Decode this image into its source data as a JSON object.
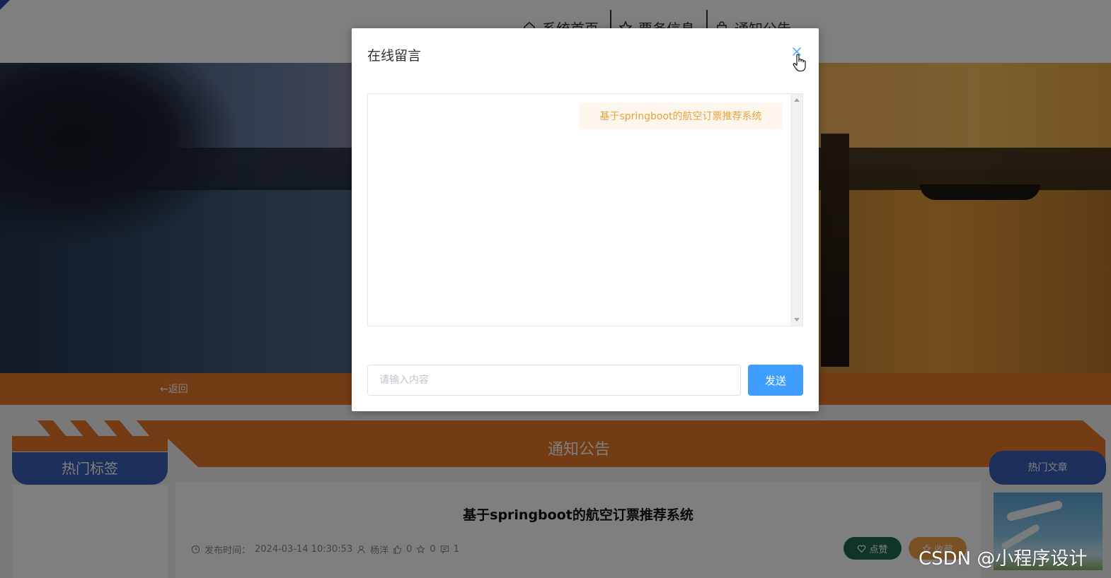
{
  "nav": {
    "items": [
      {
        "label": "系统首页",
        "icon": "home-icon"
      },
      {
        "label": "票务信息",
        "icon": "star-icon"
      },
      {
        "label": "通知公告",
        "icon": "bag-icon"
      }
    ]
  },
  "page": {
    "back_label": "←返回",
    "section_title": "通知公告",
    "hot_tags_label": "热门标签",
    "hot_articles_label": "热门文章",
    "article": {
      "title": "基于springboot的航空订票推荐系统",
      "publish_label": "发布时间：",
      "publish_time": "2024-03-14 10:30:53",
      "author": "杨洋",
      "likes": "0",
      "favorites": "0",
      "comments": "1"
    },
    "like_button": "点赞",
    "favorite_button": "收藏",
    "watermark": "CSDN @小程序设计"
  },
  "dialog": {
    "title": "在线留言",
    "messages": [
      "基于springboot的航空订票推荐系统"
    ],
    "input_placeholder": "请输入内容",
    "input_value": "",
    "send_label": "发送"
  },
  "colors": {
    "accent_orange": "#e8792b",
    "accent_blue": "#3a5fb6",
    "primary_button": "#409eff",
    "bubble_bg": "#fdf6ec",
    "bubble_text": "#e6a23c",
    "like_green": "#1d6b4f"
  }
}
